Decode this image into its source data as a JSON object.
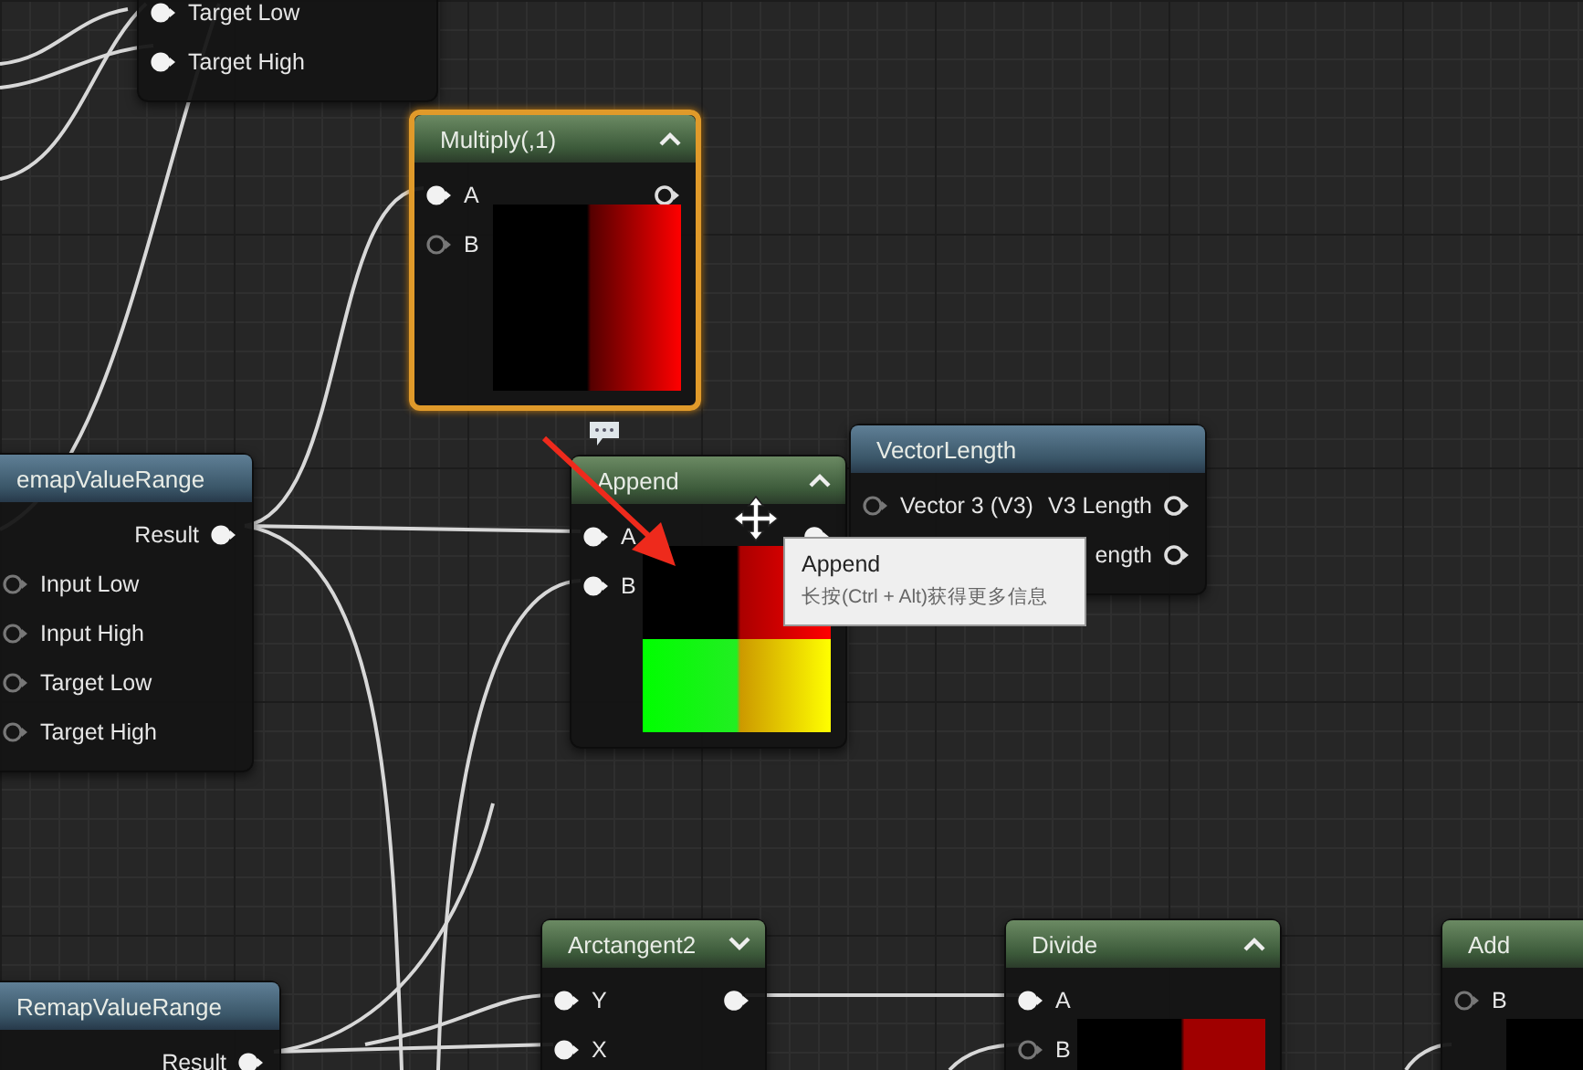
{
  "nodes": [
    {
      "kind": "stacked-function",
      "selected": false,
      "inputs": [
        {
          "label": "Target Low",
          "connected": true
        },
        {
          "label": "Target High",
          "connected": true
        }
      ]
    },
    {
      "kind": "expression",
      "title": "Multiply(,1)",
      "expanded": true,
      "selected": true,
      "inputs": [
        {
          "label": "A",
          "connected": true
        },
        {
          "label": "B",
          "connected": false
        }
      ],
      "outputs": [
        {
          "connected": false
        }
      ],
      "preview": {
        "kind": "two-tone"
      }
    },
    {
      "kind": "expression",
      "title": "Append",
      "expanded": true,
      "selected": false,
      "inputs": [
        {
          "label": "A",
          "connected": true
        },
        {
          "label": "B",
          "connected": true
        }
      ],
      "outputs": [
        {
          "connected": true
        }
      ],
      "preview": {
        "kind": "quad"
      }
    },
    {
      "kind": "function",
      "title": "VectorLength",
      "selected": false,
      "inputs": [
        {
          "label": "Vector 3 (V3)",
          "connected": false
        }
      ],
      "outputs": [
        {
          "label": "V3 Length",
          "connected": false
        },
        {
          "label": "ength",
          "connected": false
        }
      ]
    },
    {
      "kind": "stacked-function",
      "title": "emapValueRange",
      "selected": false,
      "inputs": [
        {
          "label": "Input Low",
          "connected": false
        },
        {
          "label": "Input High",
          "connected": false
        },
        {
          "label": "Target Low",
          "connected": false
        },
        {
          "label": "Target High",
          "connected": false
        }
      ],
      "outputs": [
        {
          "label": "Result",
          "connected": true
        }
      ]
    },
    {
      "kind": "expression",
      "title": "Arctangent2",
      "expanded": false,
      "selected": false,
      "inputs": [
        {
          "label": "Y",
          "connected": true
        },
        {
          "label": "X",
          "connected": true
        }
      ],
      "outputs": [
        {
          "connected": true
        }
      ]
    },
    {
      "kind": "stacked-function",
      "title": "RemapValueRange",
      "selected": false,
      "outputs": [
        {
          "label": "Result",
          "connected": true
        }
      ]
    },
    {
      "kind": "expression",
      "title": "Divide",
      "expanded": true,
      "selected": false,
      "inputs": [
        {
          "label": "A",
          "connected": true
        },
        {
          "label": "B",
          "connected": false
        }
      ],
      "preview": {
        "kind": "dark"
      }
    },
    {
      "kind": "expression",
      "title": "Add",
      "selected": false,
      "inputs": [
        {
          "label": "B",
          "connected": false
        }
      ],
      "preview": {
        "kind": "dark"
      }
    }
  ],
  "tooltip": {
    "title": "Append",
    "hint": "长按(Ctrl + Alt)获得更多信息"
  }
}
